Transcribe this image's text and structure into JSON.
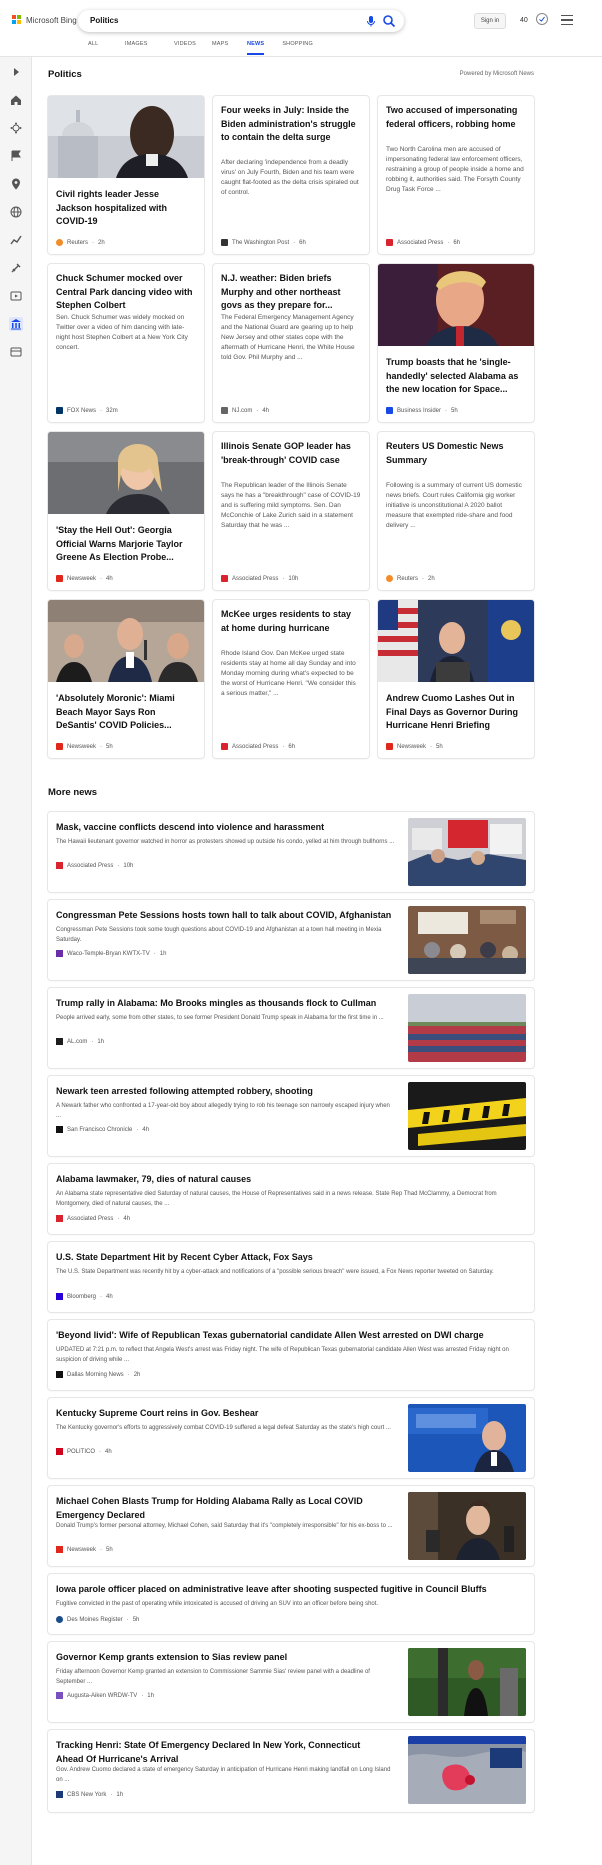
{
  "header": {
    "logo_text": "Microsoft Bing",
    "search_query": "Politics",
    "signin": "Sign in",
    "points": "40",
    "tabs": [
      "ALL",
      "IMAGES",
      "VIDEOS",
      "MAPS",
      "NEWS",
      "SHOPPING"
    ],
    "active_tab": "NEWS"
  },
  "politics": {
    "title": "Politics",
    "powered": "Powered by Microsoft News",
    "cards": [
      {
        "title": "Civil rights leader Jesse Jackson hospitalized with COVID-19",
        "snippet": "",
        "source": "Reuters",
        "time": "2h",
        "image": "portrait"
      },
      {
        "title": "Four weeks in July: Inside the Biden administration's struggle to contain the delta surge",
        "snippet": "After declaring 'independence from a deadly virus' on July Fourth, Biden and his team were caught flat-footed as the delta crisis spiraled out of control.",
        "source": "The Washington Post",
        "time": "6h",
        "image": ""
      },
      {
        "title": "Two accused of impersonating federal officers, robbing home",
        "snippet": "Two North Carolina men are accused of impersonating federal law enforcement officers, restraining a group of people inside a home and robbing it, authorities said. The Forsyth County Drug Task Force ...",
        "source": "Associated Press",
        "time": "6h",
        "image": ""
      },
      {
        "title": "Chuck Schumer mocked over Central Park dancing video with Stephen Colbert",
        "snippet": "Sen. Chuck Schumer was widely mocked on Twitter over a video of him dancing with late-night host Stephen Colbert at a New York City concert.",
        "source": "FOX News",
        "time": "32m",
        "image": ""
      },
      {
        "title": "N.J. weather: Biden briefs Murphy and other northeast govs as they prepare for...",
        "snippet": "The Federal Emergency Management Agency and the National Guard are gearing up to help New Jersey and other states cope with the aftermath of Hurricane Henri, the White House told Gov. Phil Murphy and ...",
        "source": "NJ.com",
        "time": "4h",
        "image": ""
      },
      {
        "title": "Trump boasts that he 'single-handedly' selected Alabama as the new location for Space...",
        "snippet": "",
        "source": "Business Insider",
        "time": "5h",
        "image": "trump"
      },
      {
        "title": "'Stay the Hell Out': Georgia Official Warns Marjorie Taylor Greene As Election Probe...",
        "snippet": "",
        "source": "Newsweek",
        "time": "4h",
        "image": "woman"
      },
      {
        "title": "Illinois Senate GOP leader has 'break-through' COVID case",
        "snippet": "The Republican leader of the Illinois Senate says he has a \"breakthrough\" case of COVID-19 and is suffering mild symptoms. Sen. Dan McConchie of Lake Zurich said in a statement Saturday that he was ...",
        "source": "Associated Press",
        "time": "10h",
        "image": ""
      },
      {
        "title": "Reuters US Domestic News Summary",
        "snippet": "Following is a summary of current US domestic news briefs. Court rules California gig worker initiative is unconstitutional A 2020 ballot measure that exempted ride-share and food delivery ...",
        "source": "Reuters",
        "time": "2h",
        "image": ""
      },
      {
        "title": "'Absolutely Moronic': Miami Beach Mayor Says Ron DeSantis' COVID Policies...",
        "snippet": "",
        "source": "Newsweek",
        "time": "5h",
        "image": "podium"
      },
      {
        "title": "McKee urges residents to stay at home during hurricane",
        "snippet": "Rhode Island Gov. Dan McKee urged state residents stay at home all day Sunday and into Monday morning during what's expected to be the worst of Hurricane Henri. \"We consider this a serious matter,\" ...",
        "source": "Associated Press",
        "time": "6h",
        "image": ""
      },
      {
        "title": "Andrew Cuomo Lashes Out in Final Days as Governor During Hurricane Henri Briefing",
        "snippet": "",
        "source": "Newsweek",
        "time": "5h",
        "image": "flags"
      }
    ]
  },
  "more_news": {
    "title": "More news",
    "items": [
      {
        "title": "Mask, vaccine conflicts descend into violence and harassment",
        "snippet": "The Hawaii lieutenant governor watched in horror as protesters showed up outside his condo, yelled at him through bullhorns ...",
        "source": "Associated Press",
        "time": "10h",
        "image": "protest"
      },
      {
        "title": "Congressman Pete Sessions hosts town hall to talk about COVID, Afghanistan",
        "snippet": "Congressman Pete Sessions took some tough questions about COVID-19 and Afghanistan at a town hall meeting in Mexia Saturday.",
        "source": "Waco-Temple-Bryan KWTX-TV",
        "time": "1h",
        "image": "townhall"
      },
      {
        "title": "Trump rally in Alabama: Mo Brooks mingles as thousands flock to Cullman",
        "snippet": "People arrived early, some from other states, to see former President Donald Trump speak in Alabama for the first time in ...",
        "source": "AL.com",
        "time": "1h",
        "image": "crowd"
      },
      {
        "title": "Newark teen arrested following attempted robbery, shooting",
        "snippet": "A Newark father who confronted a 17-year-old boy about allegedly trying to rob his teenage son narrowly escaped injury when ...",
        "source": "San Francisco Chronicle",
        "time": "4h",
        "image": "crime"
      },
      {
        "title": "Alabama lawmaker, 79, dies of natural causes",
        "snippet": "An Alabama state representative died Saturday of natural causes, the House of Representatives said in a news release. State Rep Thad McClammy, a Democrat from Montgomery, died of natural causes, the ...",
        "source": "Associated Press",
        "time": "4h",
        "image": ""
      },
      {
        "title": "U.S. State Department Hit by Recent Cyber Attack, Fox Says",
        "snippet": "The U.S. State Department was recently hit by a cyber-attack and notifications of a \"possible serious breach\" were issued, a Fox News reporter tweeted on Saturday.",
        "source": "Bloomberg",
        "time": "4h",
        "image": ""
      },
      {
        "title": "'Beyond livid': Wife of Republican Texas gubernatorial candidate Allen West arrested on DWI charge",
        "snippet": "UPDATED at 7:21 p.m. to reflect that Angela West's arrest was Friday night. The wife of Republican Texas gubernatorial candidate Allen West was arrested Friday night on suspicion of driving while ...",
        "source": "Dallas Morning News",
        "time": "2h",
        "image": ""
      },
      {
        "title": "Kentucky Supreme Court reins in Gov. Beshear",
        "snippet": "The Kentucky governor's efforts to aggressively combat COVID-19 suffered a legal defeat Saturday as the state's high court ...",
        "source": "POLITICO",
        "time": "4h",
        "image": "kentucky"
      },
      {
        "title": "Michael Cohen Blasts Trump for Holding Alabama Rally as Local COVID Emergency Declared",
        "snippet": "Donald Trump's former personal attorney, Michael Cohen, said Saturday that it's \"completely irresponsible\" for his ex-boss to ...",
        "source": "Newsweek",
        "time": "5h",
        "image": "cohen"
      },
      {
        "title": "Iowa parole officer placed on administrative leave after shooting suspected fugitive in Council Bluffs",
        "snippet": "Fugitive convicted in the past of operating while intoxicated is accused of driving an SUV into an officer before being shot.",
        "source": "Des Moines Register",
        "time": "5h",
        "image": ""
      },
      {
        "title": "Governor Kemp grants extension to Sias review panel",
        "snippet": "Friday afternoon Governor Kemp granted an extension to Commissioner Sammie Sias' review panel with a deadline of September ...",
        "source": "Augusta-Aiken WRDW-TV",
        "time": "1h",
        "image": "kemp"
      },
      {
        "title": "Tracking Henri: State Of Emergency Declared In New York, Connecticut Ahead Of Hurricane's Arrival",
        "snippet": "Gov. Andrew Cuomo declared a state of emergency Saturday in anticipation of Hurricane Henri making landfall on Long Island on ...",
        "source": "CBS New York",
        "time": "1h",
        "image": "map"
      }
    ]
  },
  "colors": {
    "accent": "#174ae4",
    "reuters": "#f38b29",
    "ap": "#d9232e",
    "newsweek": "#e1261c",
    "foxnews": "#003366",
    "bloomberg": "#2800d7",
    "politico": "#d0021b"
  }
}
